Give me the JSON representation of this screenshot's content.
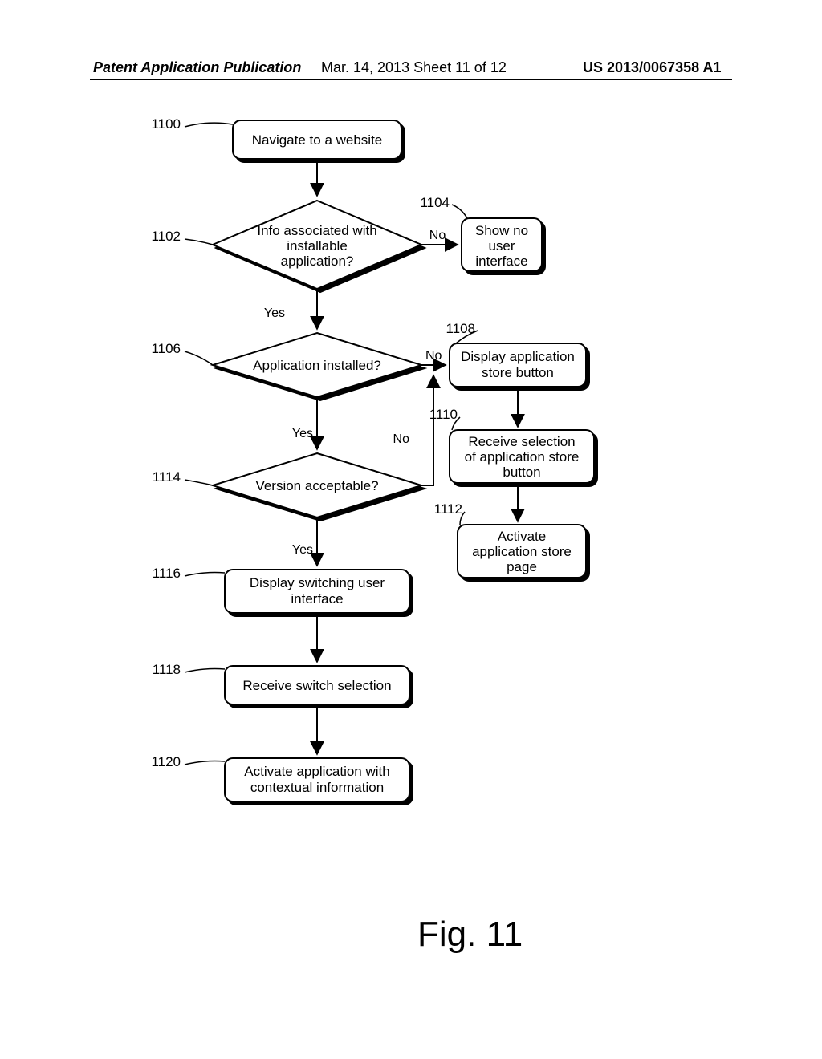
{
  "header": {
    "left": "Patent Application Publication",
    "mid": "Mar. 14, 2013  Sheet 11 of 12",
    "right": "US 2013/0067358 A1"
  },
  "figure_caption": "Fig. 11",
  "refs": {
    "n1100": "1100",
    "n1102": "1102",
    "n1104": "1104",
    "n1106": "1106",
    "n1108": "1108",
    "n1110": "1110",
    "n1112": "1112",
    "n1114": "1114",
    "n1116": "1116",
    "n1118": "1118",
    "n1120": "1120"
  },
  "nodes": {
    "n1100": "Navigate to a website",
    "n1102_l1": "Info associated with",
    "n1102_l2": "installable",
    "n1102_l3": "application?",
    "n1104_l1": "Show no",
    "n1104_l2": "user",
    "n1104_l3": "interface",
    "n1106": "Application installed?",
    "n1108_l1": "Display application",
    "n1108_l2": "store button",
    "n1110_l1": "Receive selection",
    "n1110_l2": "of application store",
    "n1110_l3": "button",
    "n1112_l1": "Activate",
    "n1112_l2": "application store",
    "n1112_l3": "page",
    "n1114": "Version acceptable?",
    "n1116_l1": "Display switching user",
    "n1116_l2": "interface",
    "n1118": "Receive switch selection",
    "n1120_l1": "Activate application with",
    "n1120_l2": "contextual information"
  },
  "edges": {
    "yes": "Yes",
    "no": "No"
  }
}
